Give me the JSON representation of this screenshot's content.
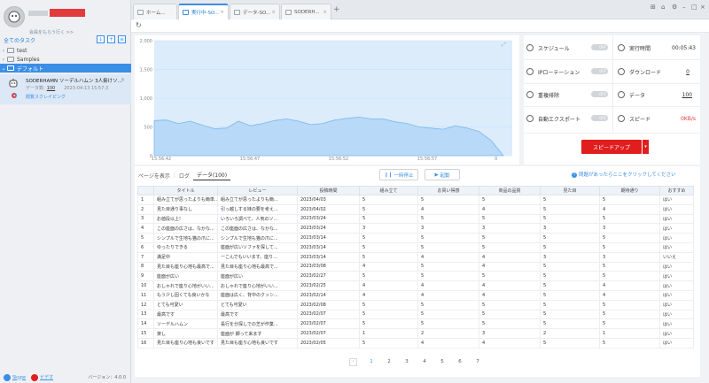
{
  "sidebar": {
    "member_link": "会員をもらう行く >>",
    "all_tasks_label": "全てのタスク",
    "tree": [
      {
        "label": "test"
      },
      {
        "label": "Samples"
      },
      {
        "label": "デフォルト"
      }
    ],
    "task": {
      "title": "SODERHAMN ソーデルハムン 3人掛けソ...",
      "data_label": "データ数:",
      "data_count": "100",
      "time": "2023-04-13 15:57:3",
      "status": "閲覧スクレイピング"
    },
    "footer": {
      "link1": "Skype",
      "link2": "ビデオ",
      "version": "バージョン：4.0.0"
    }
  },
  "tabs": [
    {
      "label": "ホーム..."
    },
    {
      "label": "実行中-SO..."
    },
    {
      "label": "データ-SO..."
    },
    {
      "label": "SODERH..."
    }
  ],
  "chart_data": {
    "type": "area",
    "x": [
      "15:56:42",
      "15:56:47",
      "15:56:52",
      "15:56:57"
    ],
    "y_ticks": [
      "2,000",
      "1,500",
      "1,000",
      "500",
      "0"
    ],
    "ylim": [
      0,
      2000
    ],
    "series": [
      {
        "values": [
          610,
          620,
          560,
          600,
          530,
          470,
          480,
          600,
          520,
          560,
          610,
          640,
          600,
          540,
          560,
          620,
          650,
          670,
          640,
          640,
          590,
          560,
          500,
          480,
          460,
          520,
          480,
          420,
          260,
          0
        ]
      }
    ]
  },
  "controls": {
    "schedule": "スケジュール",
    "runtime_label": "実行時間",
    "runtime_value": "00:05:43",
    "ip_rotation": "IPローテーション",
    "download_label": "ダウンロード",
    "download_value": "0",
    "dedupe": "重複排除",
    "data_label": "データ",
    "data_value": "100",
    "auto_export": "自動エクスポート",
    "speed_label": "スピード",
    "speed_value": "0KB/s",
    "toggle_off": "OFF",
    "speedup_button": "スピードアップ"
  },
  "bottom": {
    "sub_tabs": [
      "ページを表示",
      "ログ",
      "データ(100)"
    ],
    "pause": "一時停止",
    "start": "起動",
    "help": "問題があったらここをクリックしてください",
    "columns": [
      "",
      "タイトル",
      "レビュー",
      "投稿時間",
      "組み立て",
      "お買い得感",
      "商品の品質",
      "見た目",
      "期待通り",
      "おすすめ"
    ],
    "rows": [
      [
        "1",
        "組み立てが思ったよりも簡単...",
        "組み立てが思ったよりも簡...",
        "2023/04/03",
        "5",
        "5",
        "5",
        "5",
        "5",
        "はい"
      ],
      [
        "2",
        "見た目通り事なし",
        "引っ越しする妹の要を考え...",
        "2023/04/02",
        "5",
        "4",
        "4",
        "5",
        "4",
        "はい"
      ],
      [
        "3",
        "お値段以上!",
        "いろいろ調べて、人気のソ...",
        "2023/03/24",
        "5",
        "5",
        "5",
        "5",
        "5",
        "はい"
      ],
      [
        "4",
        "この座面の広さは、なかな...",
        "この座面の広さは、なかな...",
        "2023/03/24",
        "3",
        "3",
        "3",
        "3",
        "3",
        "はい"
      ],
      [
        "5",
        "シンプルで生地も猫の爪に...",
        "シンプルで生地も猫の爪に...",
        "2023/03/14",
        "5",
        "5",
        "5",
        "5",
        "5",
        "はい"
      ],
      [
        "6",
        "ゆったりできる",
        "座面が広いソファを探して...",
        "2023/03/14",
        "5",
        "5",
        "5",
        "5",
        "5",
        "はい"
      ],
      [
        "7",
        "満足中",
        "ーこんでもいいます。座り...",
        "2023/03/14",
        "5",
        "4",
        "4",
        "3",
        "3",
        "いいえ"
      ],
      [
        "8",
        "見た目も座り心地も最高で...",
        "見た目も座り心地も最高で...",
        "2023/03/08",
        "4",
        "5",
        "4",
        "5",
        "5",
        "はい"
      ],
      [
        "9",
        "座面が広い",
        "座面が広い",
        "2023/02/27",
        "5",
        "5",
        "5",
        "5",
        "5",
        "はい"
      ],
      [
        "10",
        "おしゃれで座り心地がいい...",
        "おしゃれで座り心地がいい...",
        "2023/02/25",
        "4",
        "4",
        "4",
        "5",
        "4",
        "はい"
      ],
      [
        "11",
        "もう少し固くても良いかな",
        "座面は広く、背中のクッシ...",
        "2023/02/14",
        "4",
        "4",
        "4",
        "5",
        "4",
        "はい"
      ],
      [
        "12",
        "とても可愛い",
        "とても可愛い",
        "2023/02/08",
        "5",
        "5",
        "5",
        "5",
        "5",
        "はい"
      ],
      [
        "13",
        "最高です",
        "最高です",
        "2023/02/07",
        "5",
        "5",
        "5",
        "5",
        "5",
        "はい"
      ],
      [
        "14",
        "ソーデルハムン",
        "長行を分探しでの芝が作業...",
        "2023/02/07",
        "5",
        "5",
        "5",
        "5",
        "5",
        "はい"
      ],
      [
        "15",
        "楽し",
        "座面が 脚って来ます",
        "2023/02/07",
        "1",
        "2",
        "3",
        "2",
        "1",
        "はい"
      ],
      [
        "16",
        "見た目も座り心地も良いです",
        "見た目も座り心地も良いです",
        "2023/02/05",
        "5",
        "4",
        "4",
        "5",
        "5",
        "はい"
      ]
    ],
    "pages": [
      "1",
      "2",
      "3",
      "4",
      "5",
      "6",
      "7"
    ]
  },
  "colors": {
    "accent": "#3a8ee6",
    "brand_red": "#e01e1e",
    "chart_fill": "#b8d9f7"
  }
}
